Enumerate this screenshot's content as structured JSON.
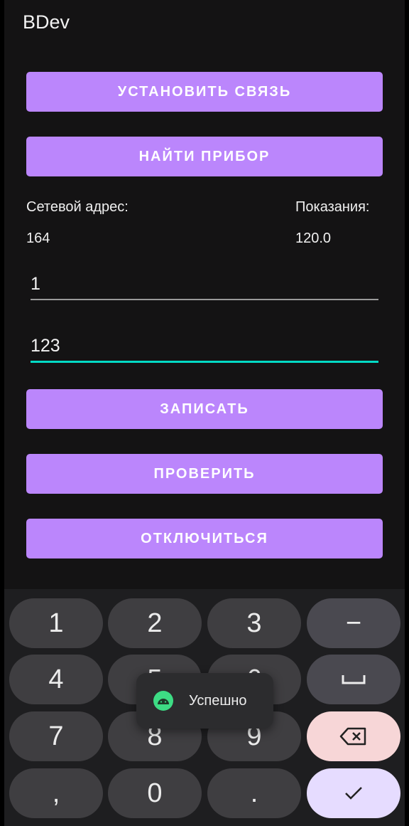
{
  "app": {
    "title": "BDev"
  },
  "buttons": {
    "connect": "УСТАНОВИТЬ СВЯЗЬ",
    "find_device": "НАЙТИ ПРИБОР",
    "write": "ЗАПИСАТЬ",
    "check": "ПРОВЕРИТЬ",
    "disconnect": "ОТКЛЮЧИТЬСЯ"
  },
  "info": {
    "address_label": "Сетевой адрес:",
    "address_value": "164",
    "reading_label": "Показания:",
    "reading_value": "120.0"
  },
  "fields": {
    "field1_value": "1",
    "field2_value": "123"
  },
  "keyboard": {
    "keys": [
      "1",
      "2",
      "3",
      "−",
      "4",
      "5",
      "6",
      "␣",
      "7",
      "8",
      "9",
      "⌫",
      ",",
      "0",
      ".",
      "✓"
    ]
  },
  "toast": {
    "text": "Успешно"
  },
  "colors": {
    "accent": "#bb86fc",
    "focus_underline": "#03dac5",
    "background": "#141314"
  }
}
